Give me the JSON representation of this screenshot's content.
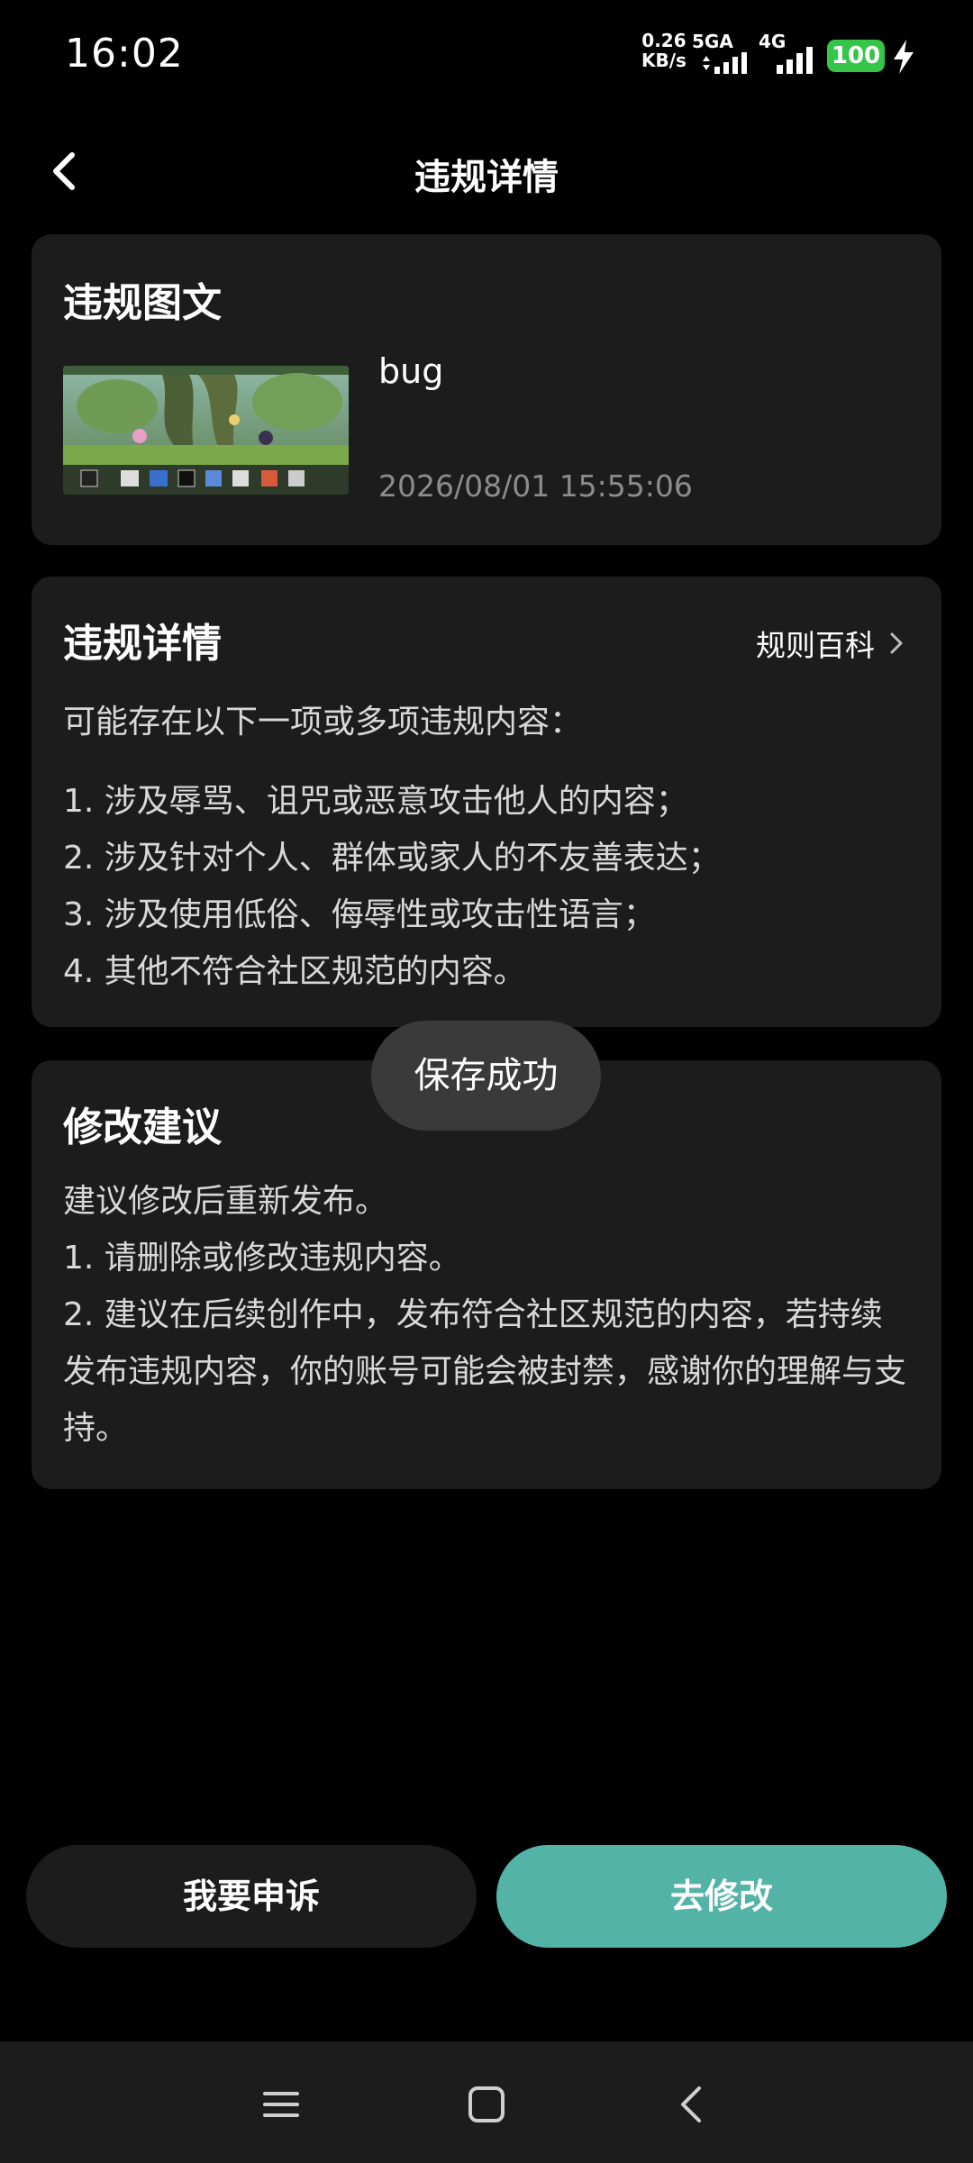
{
  "status_bar": {
    "time": "16:02",
    "net_speed_value": "0.26",
    "net_speed_unit": "KB/s",
    "network_5g": "5GA",
    "network_4g": "4G",
    "battery": "100",
    "battery_color": "#35c548"
  },
  "header": {
    "title": "违规详情",
    "back_icon": "chevron-left-icon"
  },
  "post_card": {
    "title": "违规图文",
    "post_text": "bug",
    "post_time": "2026/08/01 15:55:06"
  },
  "details_card": {
    "title": "违规详情",
    "rules_link": "规则百科",
    "intro": "可能存在以下一项或多项违规内容：",
    "items": [
      "1. 涉及辱骂、诅咒或恶意攻击他人的内容；",
      "2. 涉及针对个人、群体或家人的不友善表达；",
      "3. 涉及使用低俗、侮辱性或攻击性语言；",
      "4. 其他不符合社区规范的内容。"
    ]
  },
  "suggest_card": {
    "title": "修改建议",
    "lines": [
      "建议修改后重新发布。",
      "1. 请删除或修改违规内容。",
      "2. 建议在后续创作中，发布符合社区规范的内容，若持续发布违规内容，你的账号可能会被封禁，感谢你的理解与支持。"
    ]
  },
  "toast": {
    "text": "保存成功"
  },
  "actions": {
    "appeal_label": "我要申诉",
    "edit_label": "去修改",
    "accent_color": "#53b3a6"
  },
  "nav_bar": {
    "icons": [
      "menu-icon",
      "home-square-icon",
      "back-triangle-icon"
    ]
  }
}
